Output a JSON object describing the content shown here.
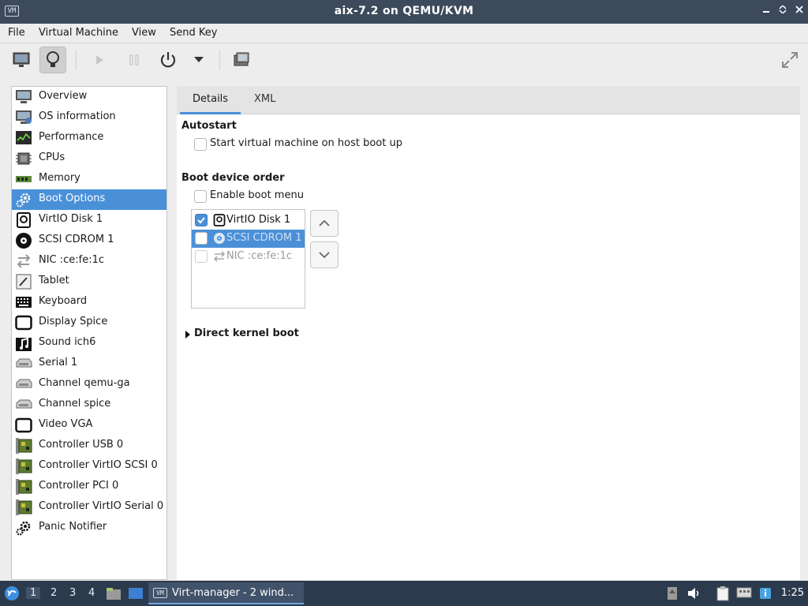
{
  "window": {
    "title": "aix-7.2 on QEMU/KVM"
  },
  "menubar": {
    "items": [
      "File",
      "Virtual Machine",
      "View",
      "Send Key"
    ]
  },
  "sidebar": {
    "items": [
      {
        "label": "Overview",
        "icon": "monitor-icon"
      },
      {
        "label": "OS information",
        "icon": "monitor-info-icon"
      },
      {
        "label": "Performance",
        "icon": "performance-graph-icon"
      },
      {
        "label": "CPUs",
        "icon": "cpu-chip-icon"
      },
      {
        "label": "Memory",
        "icon": "memory-module-icon"
      },
      {
        "label": "Boot Options",
        "icon": "gears-icon"
      },
      {
        "label": "VirtIO Disk 1",
        "icon": "disk-icon"
      },
      {
        "label": "SCSI CDROM 1",
        "icon": "cdrom-icon"
      },
      {
        "label": "NIC :ce:fe:1c",
        "icon": "network-arrows-icon"
      },
      {
        "label": "Tablet",
        "icon": "tablet-icon"
      },
      {
        "label": "Keyboard",
        "icon": "keyboard-icon"
      },
      {
        "label": "Display Spice",
        "icon": "display-icon"
      },
      {
        "label": "Sound ich6",
        "icon": "sound-icon"
      },
      {
        "label": "Serial 1",
        "icon": "serial-port-icon"
      },
      {
        "label": "Channel qemu-ga",
        "icon": "channel-icon"
      },
      {
        "label": "Channel spice",
        "icon": "channel-icon"
      },
      {
        "label": "Video VGA",
        "icon": "video-icon"
      },
      {
        "label": "Controller USB 0",
        "icon": "controller-card-icon"
      },
      {
        "label": "Controller VirtIO SCSI 0",
        "icon": "controller-card-icon"
      },
      {
        "label": "Controller PCI 0",
        "icon": "controller-card-icon"
      },
      {
        "label": "Controller VirtIO Serial 0",
        "icon": "controller-card-icon"
      },
      {
        "label": "Panic Notifier",
        "icon": "gear-icon"
      }
    ],
    "selected_index": 5
  },
  "tabs": [
    "Details",
    "XML"
  ],
  "autostart": {
    "title": "Autostart",
    "checkbox_label": "Start virtual machine on host boot up"
  },
  "boot_order": {
    "title": "Boot device order",
    "enable_menu_label": "Enable boot menu",
    "devices": [
      {
        "label": "VirtIO Disk 1",
        "checked": true
      },
      {
        "label": "SCSI CDROM 1",
        "checked": false
      },
      {
        "label": "NIC :ce:fe:1c",
        "checked": false
      }
    ]
  },
  "direct_kernel": {
    "title": "Direct kernel boot"
  },
  "taskbar": {
    "workspaces": [
      "1",
      "2",
      "3",
      "4"
    ],
    "task_label": "Virt-manager - 2 wind...",
    "clock": "1:25"
  },
  "colors": {
    "accent": "#4a90d9",
    "titlebar": "#3c4a5c",
    "taskbar": "#2b3a4c"
  }
}
